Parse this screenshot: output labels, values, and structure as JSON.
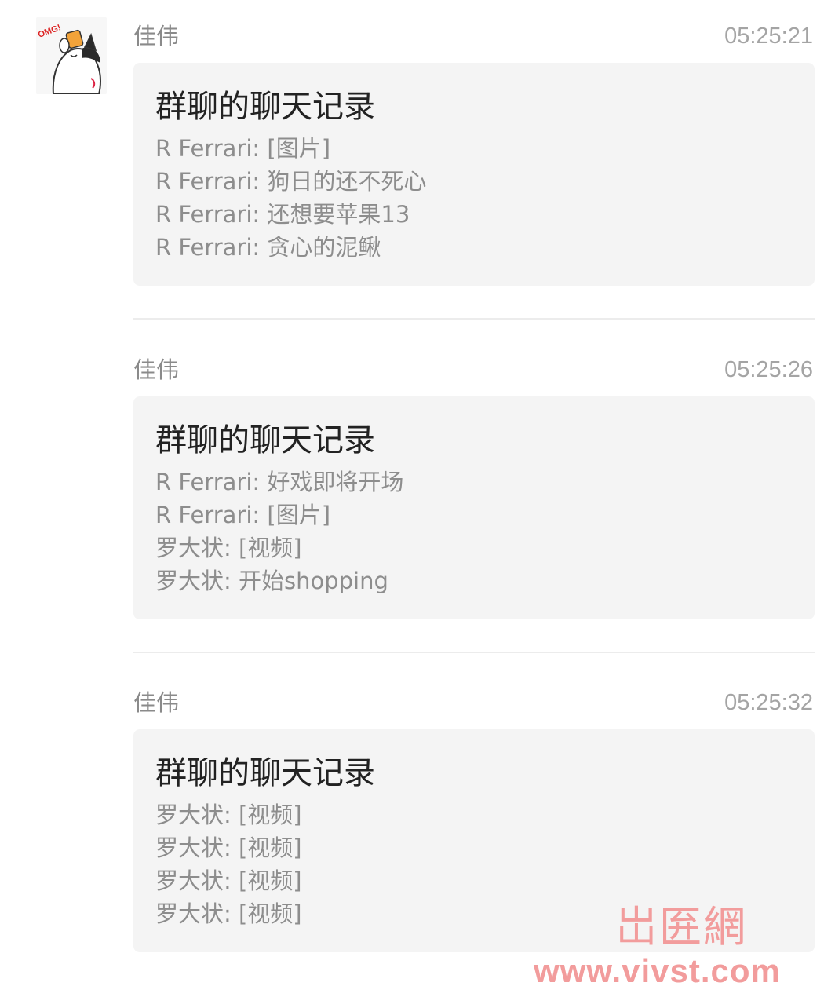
{
  "messages": [
    {
      "sender": "佳伟",
      "time": "05:25:21",
      "card": {
        "title": "群聊的聊天记录",
        "lines": [
          "R Ferrari: [图片]",
          "R Ferrari: 狗日的还不死心",
          "R Ferrari: 还想要苹果13",
          "R Ferrari: 贪心的泥鳅"
        ]
      }
    },
    {
      "sender": "佳伟",
      "time": "05:25:26",
      "card": {
        "title": "群聊的聊天记录",
        "lines": [
          "R Ferrari: 好戏即将开场",
          "R Ferrari: [图片]",
          "罗大状: [视频]",
          "罗大状: 开始shopping"
        ]
      }
    },
    {
      "sender": "佳伟",
      "time": "05:25:32",
      "card": {
        "title": "群聊的聊天记录",
        "lines": [
          "罗大状: [视频]",
          "罗大状: [视频]",
          "罗大状: [视频]",
          "罗大状: [视频]"
        ]
      }
    }
  ],
  "avatar": {
    "icon": "cartoon-cat-avatar-icon",
    "text": "OMG!"
  },
  "watermark": {
    "logo_text": "岀匥網",
    "url": "www.vivst.com",
    "color": "#f29c9c"
  },
  "colors": {
    "card_background": "#f4f4f4",
    "title_text": "#222222",
    "preview_text": "#8d8d8d",
    "meta_text": "#8a8a8a"
  }
}
